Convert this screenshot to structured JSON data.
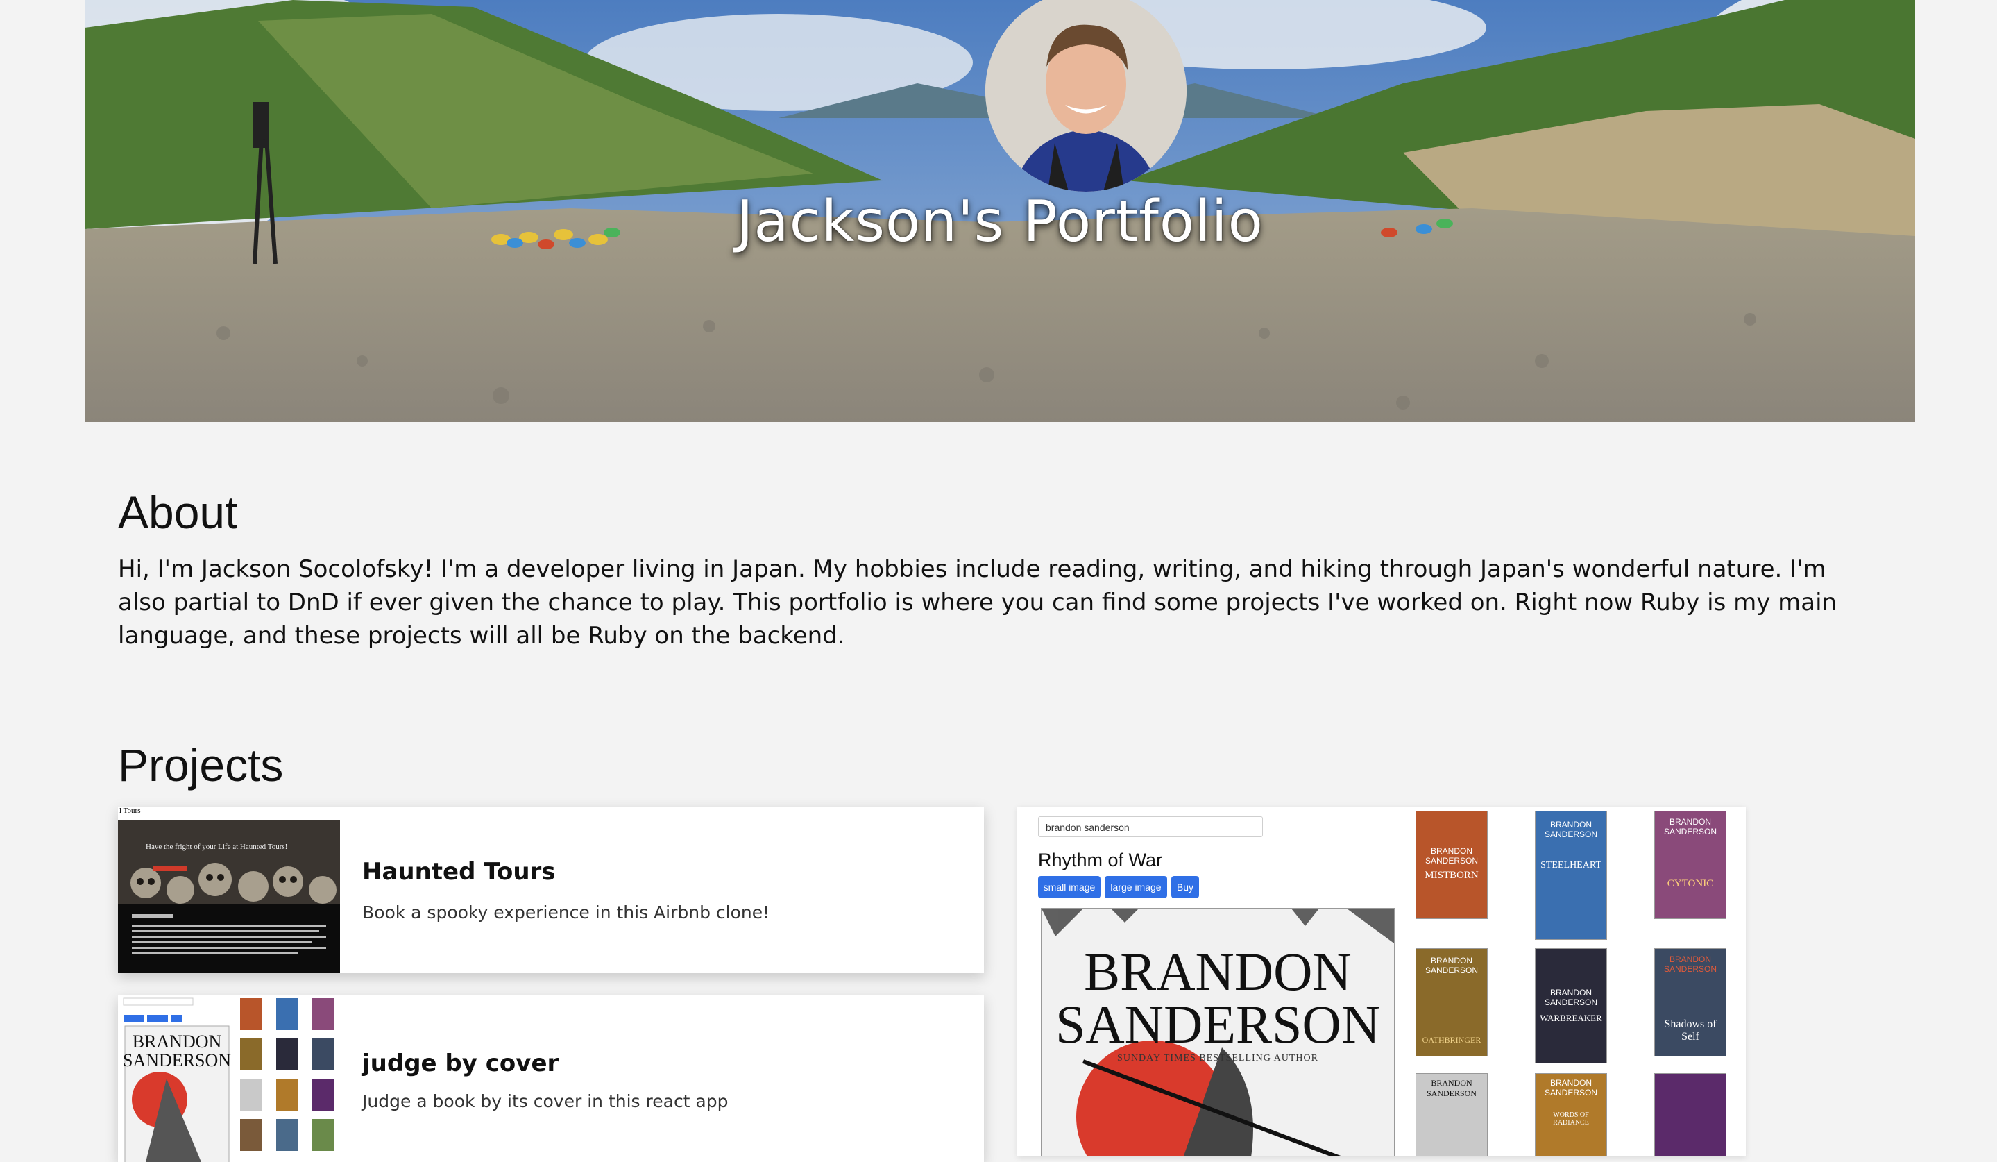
{
  "hero": {
    "title": "Jackson's Portfolio"
  },
  "about": {
    "heading": "About",
    "text": "Hi, I'm Jackson Socolofsky! I'm a developer living in Japan. My hobbies include reading, writing, and hiking through Japan's wonderful nature. I'm also partial to DnD if ever given the chance to play. This portfolio is where you can find some projects I've worked on. Right now Ruby is my main language, and these projects will all be Ruby on the backend."
  },
  "projects": {
    "heading": "Projects",
    "items": [
      {
        "title": "Haunted Tours",
        "description": "Book a spooky experience in this Airbnb clone!",
        "thumb_banner": "Have the fright of your Life at Haunted Tours!",
        "thumb_brand": "l Tours"
      },
      {
        "title": "judge by cover",
        "description": "Judge a book by its cover in this react app"
      }
    ]
  },
  "preview": {
    "search_value": "brandon sanderson",
    "book_title": "Rhythm of War",
    "buttons": [
      "small image",
      "large image",
      "Buy"
    ],
    "cover_author_line1": "BRANDON",
    "cover_author_line2": "SANDERSON",
    "cover_tagline": "SUNDAY TIMES BESTSELLING AUTHOR",
    "thumbnails": [
      {
        "author": "BRANDON SANDERSON",
        "title": "MISTBORN",
        "color": "#b8552a"
      },
      {
        "author": "BRANDON SANDERSON",
        "title": "STEELHEART",
        "color": "#3a6fb0"
      },
      {
        "author": "BRANDON SANDERSON",
        "title": "CYTONIC",
        "color": "#8a4a7a"
      },
      {
        "author": "BRANDON SANDERSON",
        "title": "OATHBRINGER",
        "color": "#8a6a2a"
      },
      {
        "author": "BRANDON SANDERSON",
        "title": "WARBREAKER",
        "color": "#2a2a3a"
      },
      {
        "author": "BRANDON SANDERSON",
        "title": "Shadows of Self",
        "color": "#3b4a62"
      },
      {
        "author": "BRANDON SANDERSON",
        "title": "",
        "color": "#c9c9c9"
      },
      {
        "author": "BRANDON SANDERSON",
        "title": "WORDS OF RADIANCE",
        "color": "#b07a2a"
      },
      {
        "author": "",
        "title": "",
        "color": "#5b2a6a"
      }
    ]
  },
  "colors": {
    "background": "#f3f3f3",
    "button_blue": "#2f6fe6"
  }
}
